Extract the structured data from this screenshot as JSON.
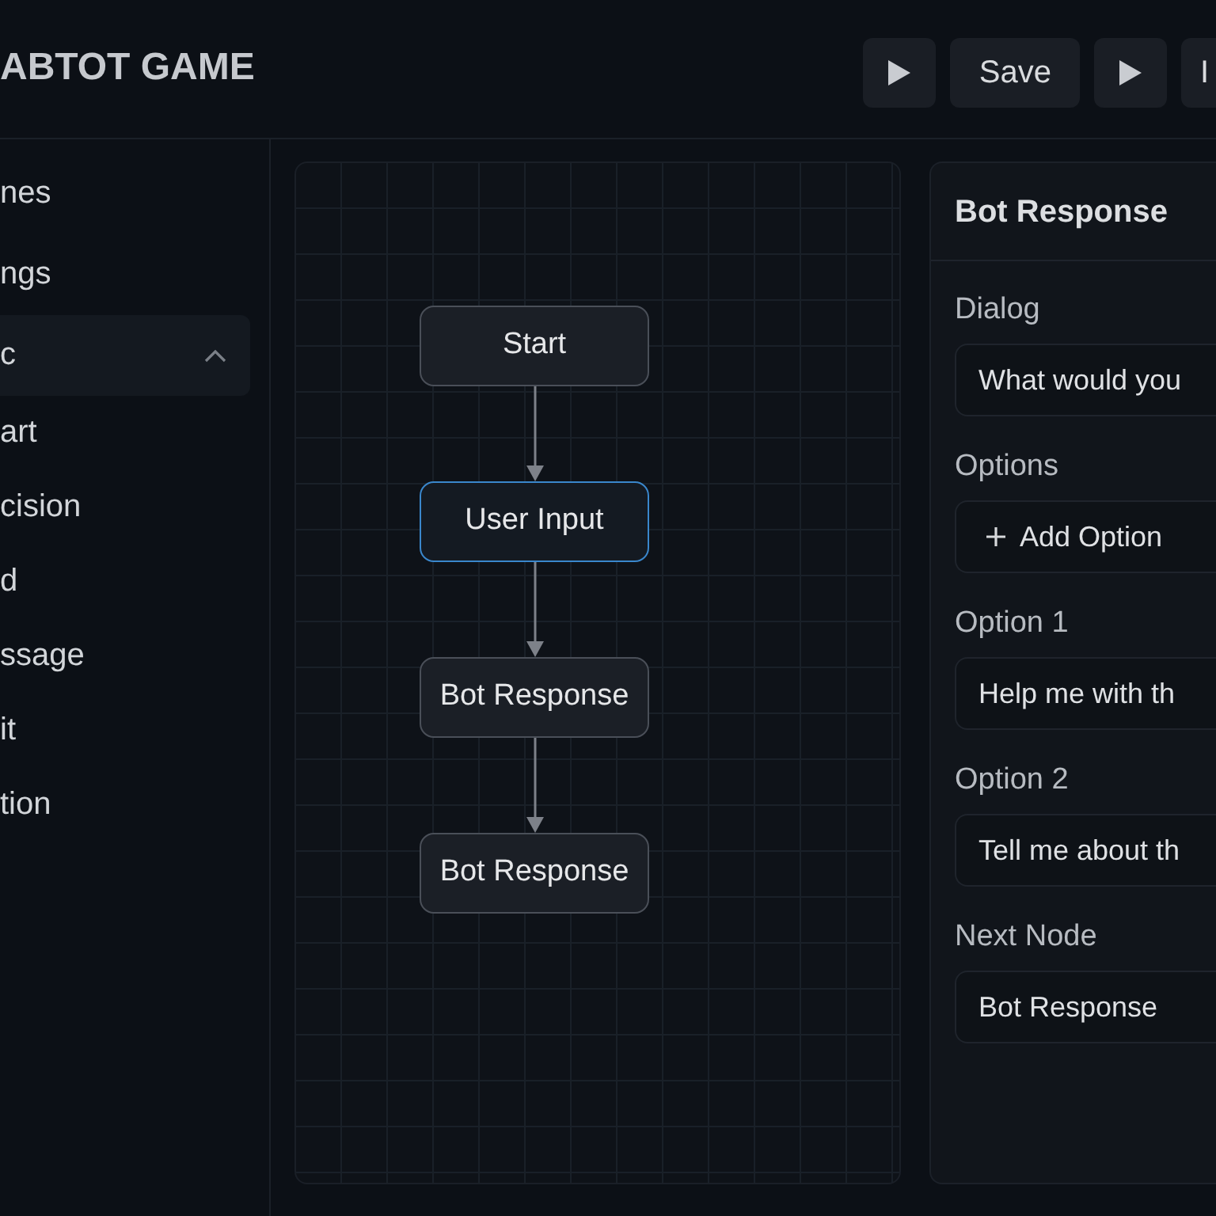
{
  "header": {
    "title": "ABTOT GAME",
    "toolbar": [
      {
        "kind": "icon"
      },
      {
        "kind": "text",
        "label": "Save"
      },
      {
        "kind": "icon"
      },
      {
        "kind": "text",
        "label": "I"
      }
    ]
  },
  "sidebar": {
    "items": [
      {
        "kind": "link",
        "label": "nes"
      },
      {
        "kind": "link",
        "label": "ngs"
      },
      {
        "kind": "group",
        "label": "c",
        "expanded": true,
        "children": [
          {
            "label": "art"
          },
          {
            "label": "cision"
          },
          {
            "label": "d"
          },
          {
            "label": "ssage"
          },
          {
            "label": "it"
          },
          {
            "label": "tion"
          }
        ]
      }
    ]
  },
  "canvas": {
    "nodes": [
      {
        "label": "Start",
        "selected": false
      },
      {
        "label": "User Input",
        "selected": true
      },
      {
        "label": "Bot Response",
        "selected": false
      },
      {
        "label": "Bot Response",
        "selected": false
      }
    ]
  },
  "inspector": {
    "title": "Bot Response",
    "fields": [
      {
        "kind": "input",
        "label": "Dialog",
        "value": "What would you"
      },
      {
        "kind": "button",
        "label": "Options",
        "button": "Add Option"
      },
      {
        "kind": "input",
        "label": "Option 1",
        "value": "Help me with th"
      },
      {
        "kind": "input",
        "label": "Option 2",
        "value": "Tell me about th"
      },
      {
        "kind": "select",
        "label": "Next Node",
        "value": "Bot Response"
      }
    ]
  }
}
